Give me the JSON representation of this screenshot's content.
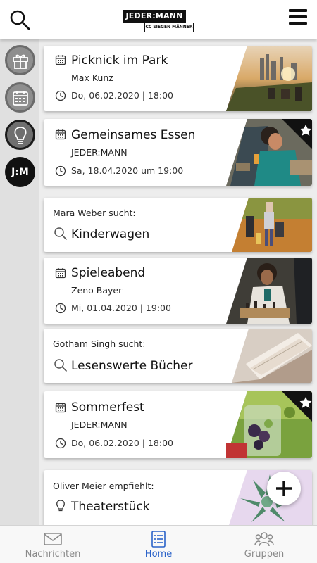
{
  "logo": {
    "main": "JEDER:MANN",
    "sub": "CC SIEGEN MÄNNER"
  },
  "topbar": {
    "search_icon": "search-icon",
    "menu_icon": "hamburger-menu-icon"
  },
  "sidebar": {
    "items": [
      {
        "icon": "gift-icon"
      },
      {
        "icon": "calendar-icon"
      },
      {
        "icon": "lightbulb-icon"
      },
      {
        "icon": "jm-logo-icon",
        "label": "J:M"
      }
    ]
  },
  "feed": {
    "events": [
      {
        "title": "Picknick im Park",
        "organizer": "Max Kunz",
        "date": "Do, 06.02.2020 | 18:00",
        "featured": false
      },
      {
        "title": "Gemeinsames Essen",
        "organizer": "JEDER:MANN",
        "date": "Sa, 18.04.2020 um 19:00",
        "featured": true
      },
      {
        "title": "Spieleabend",
        "organizer": "Zeno Bayer",
        "date": "Mi, 01.04.2020 | 19:00",
        "featured": false
      },
      {
        "title": "Sommerfest",
        "organizer": "JEDER:MANN",
        "date": "Do, 06.02.2020 | 18:00",
        "featured": true
      }
    ],
    "searches": [
      {
        "name": "Mara Weber",
        "verb": "sucht:",
        "item": "Kinderwagen"
      },
      {
        "name": "Gotham Singh",
        "verb": "sucht:",
        "item": "Lesenswerte Bücher"
      }
    ],
    "recommendation": {
      "name": "Oliver Meier",
      "verb": "empfiehlt:",
      "item": "Theaterstück"
    }
  },
  "fab": {
    "icon": "plus-icon"
  },
  "bottom_nav": {
    "tabs": [
      {
        "label": "Nachrichten",
        "icon": "envelope-icon",
        "active": false
      },
      {
        "label": "Home",
        "icon": "list-icon",
        "active": true
      },
      {
        "label": "Gruppen",
        "icon": "group-icon",
        "active": false
      }
    ]
  },
  "colors": {
    "accent": "#2a62c9",
    "inactive": "#8a8a8a",
    "background": "#ededed"
  }
}
